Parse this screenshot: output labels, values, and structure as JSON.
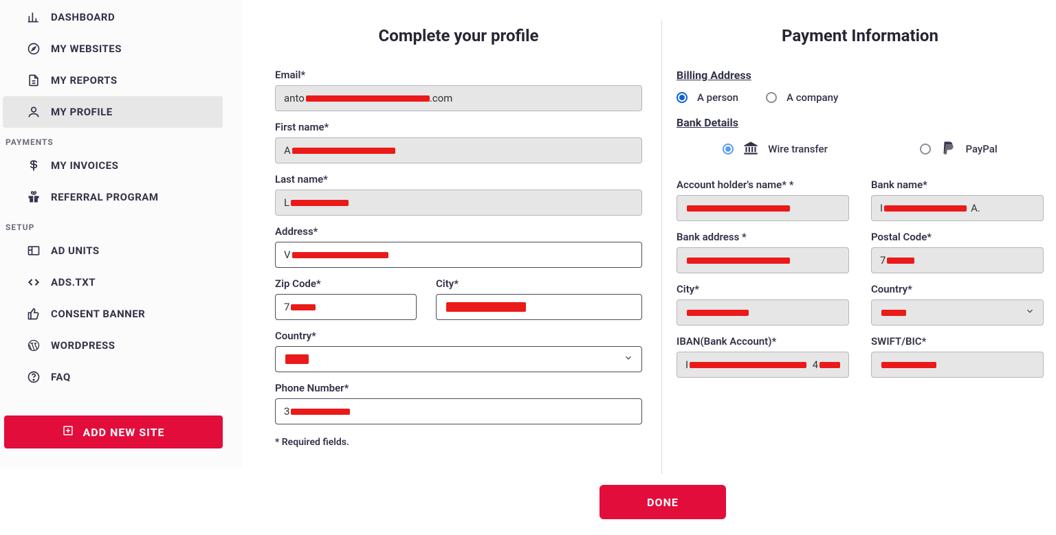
{
  "sidebar": {
    "items": [
      {
        "label": "DASHBOARD",
        "icon": "bar-chart"
      },
      {
        "label": "MY WEBSITES",
        "icon": "compass"
      },
      {
        "label": "MY REPORTS",
        "icon": "file"
      },
      {
        "label": "MY PROFILE",
        "icon": "user"
      }
    ],
    "payments_header": "PAYMENTS",
    "payments_items": [
      {
        "label": "MY INVOICES",
        "icon": "dollar"
      },
      {
        "label": "REFERRAL PROGRAM",
        "icon": "gift"
      }
    ],
    "setup_header": "SETUP",
    "setup_items": [
      {
        "label": "AD UNITS",
        "icon": "layout"
      },
      {
        "label": "ADS.TXT",
        "icon": "code"
      },
      {
        "label": "CONSENT BANNER",
        "icon": "thumb"
      },
      {
        "label": "WORDPRESS",
        "icon": "wordpress"
      },
      {
        "label": "FAQ",
        "icon": "help"
      }
    ],
    "add_site": "ADD NEW SITE"
  },
  "profile": {
    "title": "Complete your profile",
    "labels": {
      "email": "Email*",
      "first": "First name*",
      "last": "Last name*",
      "address": "Address*",
      "zip": "Zip Code*",
      "city": "City*",
      "country": "Country*",
      "phone": "Phone Number*"
    },
    "values": {
      "email_prefix": "anto",
      "email_suffix": ".com",
      "first_prefix": "A",
      "last_prefix": "L",
      "address_prefix": "V",
      "zip_prefix": "7",
      "country_prefix": "",
      "phone_prefix": "3"
    },
    "required_note": "* Required fields."
  },
  "payment": {
    "title": "Payment Information",
    "billing_label": "Billing Address",
    "entity": {
      "person": "A person",
      "company": "A company",
      "selected": "person"
    },
    "bank_label": "Bank Details",
    "method": {
      "wire": "Wire transfer",
      "paypal": "PayPal",
      "selected": "wire"
    },
    "fields": {
      "holder": "Account holder's name* *",
      "bank_name": "Bank name*",
      "bank_addr": "Bank address *",
      "postal": "Postal Code*",
      "city": "City*",
      "country": "Country*",
      "iban": "IBAN(Bank Account)*",
      "swift": "SWIFT/BIC*"
    },
    "values": {
      "bank_name_prefix": "I",
      "bank_name_suffix": "A.",
      "postal_prefix": "7",
      "iban_prefix": "I",
      "iban_suffix": "4"
    }
  },
  "done": "DONE"
}
